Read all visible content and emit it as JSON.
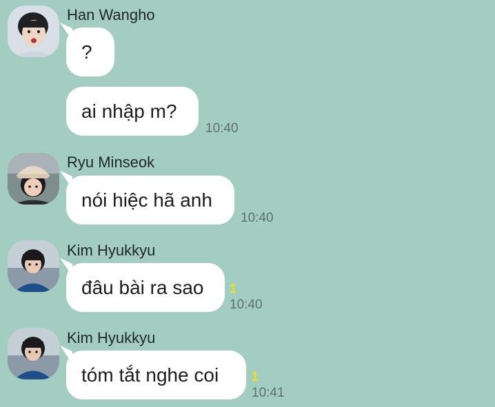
{
  "messages": [
    {
      "sender": "Han Wangho",
      "avatar": "person-avatar",
      "bubbles": [
        {
          "text": "?",
          "time": "",
          "unread": ""
        },
        {
          "text": "ai nhập m?",
          "time": "10:40",
          "unread": ""
        }
      ]
    },
    {
      "sender": "Ryu Minseok",
      "avatar": "person-avatar",
      "bubbles": [
        {
          "text": "nói hiệc hã anh",
          "time": "10:40",
          "unread": ""
        }
      ]
    },
    {
      "sender": "Kim Hyukkyu",
      "avatar": "person-avatar",
      "bubbles": [
        {
          "text": "đâu bài ra sao",
          "time": "10:40",
          "unread": "1"
        }
      ]
    },
    {
      "sender": "Kim Hyukkyu",
      "avatar": "person-avatar",
      "bubbles": [
        {
          "text": "tóm tắt nghe coi",
          "time": "10:41",
          "unread": "1"
        }
      ]
    }
  ],
  "colors": {
    "background": "#a3cdc1",
    "bubble": "#ffffff",
    "unread": "#f4e01c",
    "time": "#5f716d"
  }
}
